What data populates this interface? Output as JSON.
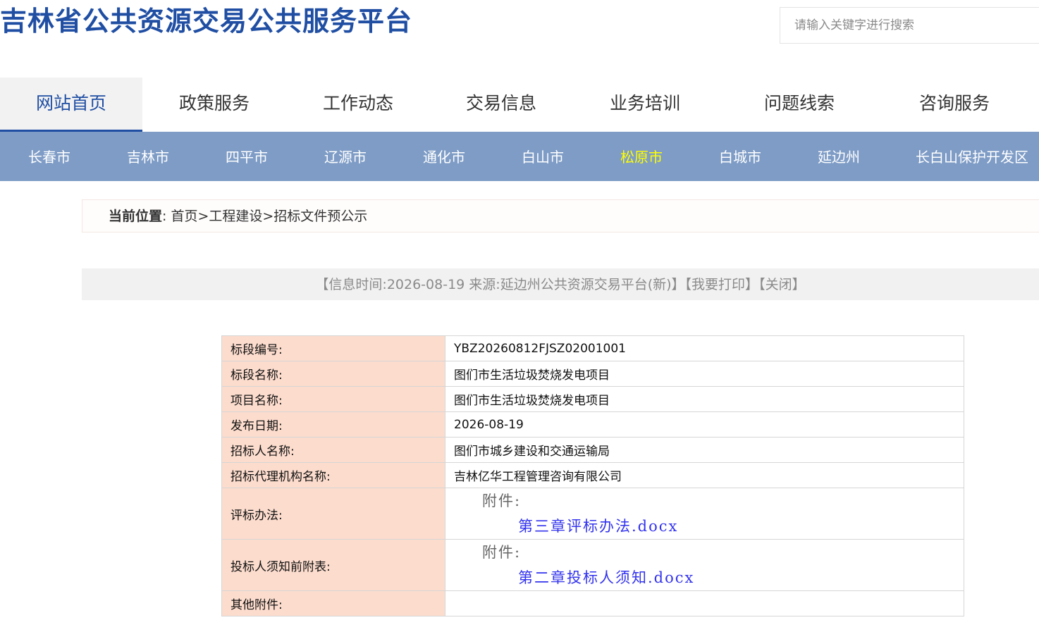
{
  "header": {
    "site_title": "吉林省公共资源交易公共服务平台",
    "search_placeholder": "请输入关键字进行搜索"
  },
  "main_nav": {
    "items": [
      {
        "label": "网站首页",
        "active": true
      },
      {
        "label": "政策服务"
      },
      {
        "label": "工作动态"
      },
      {
        "label": "交易信息"
      },
      {
        "label": "业务培训"
      },
      {
        "label": "问题线索"
      },
      {
        "label": "咨询服务"
      }
    ]
  },
  "city_nav": {
    "items": [
      {
        "label": "长春市"
      },
      {
        "label": "吉林市"
      },
      {
        "label": "四平市"
      },
      {
        "label": "辽源市"
      },
      {
        "label": "通化市"
      },
      {
        "label": "白山市"
      },
      {
        "label": "松原市",
        "active": true
      },
      {
        "label": "白城市"
      },
      {
        "label": "延边州"
      },
      {
        "label": "长白山保护开发区"
      }
    ],
    "active_color": "#ffff00"
  },
  "breadcrumb": {
    "label": "当前位置",
    "sep_colon": ":",
    "path": "首页>工程建设>招标文件预公示"
  },
  "info_bar": {
    "prefix": "【信息时间:",
    "date": "2026-08-19",
    "source_label": "来源:",
    "source": "延边州公共资源交易平台(新)",
    "suffix": "】",
    "print": "【我要打印】",
    "close": "【关闭】"
  },
  "details": {
    "rows": [
      {
        "label": "标段编号:",
        "value": "YBZ20260812FJSZ02001001"
      },
      {
        "label": "标段名称:",
        "value": "图们市生活垃圾焚烧发电项目"
      },
      {
        "label": "项目名称:",
        "value": "图们市生活垃圾焚烧发电项目"
      },
      {
        "label": "发布日期:",
        "value": "2026-08-19"
      },
      {
        "label": "招标人名称:",
        "value": "图们市城乡建设和交通运输局"
      },
      {
        "label": "招标代理机构名称:",
        "value": "吉林亿华工程管理咨询有限公司"
      }
    ],
    "attachments": [
      {
        "label": "评标办法:",
        "attach_label": "附件:",
        "file": "第三章评标办法.docx"
      },
      {
        "label": "投标人须知前附表:",
        "attach_label": "附件:",
        "file": "第二章投标人须知.docx"
      }
    ],
    "other": {
      "label": "其他附件:",
      "value": ""
    }
  },
  "colors": {
    "brand_blue": "#1f4ea3",
    "city_bar_bg": "#7e9cc6",
    "label_cell_bg": "#fcdccd",
    "link_blue": "#3333ee"
  }
}
